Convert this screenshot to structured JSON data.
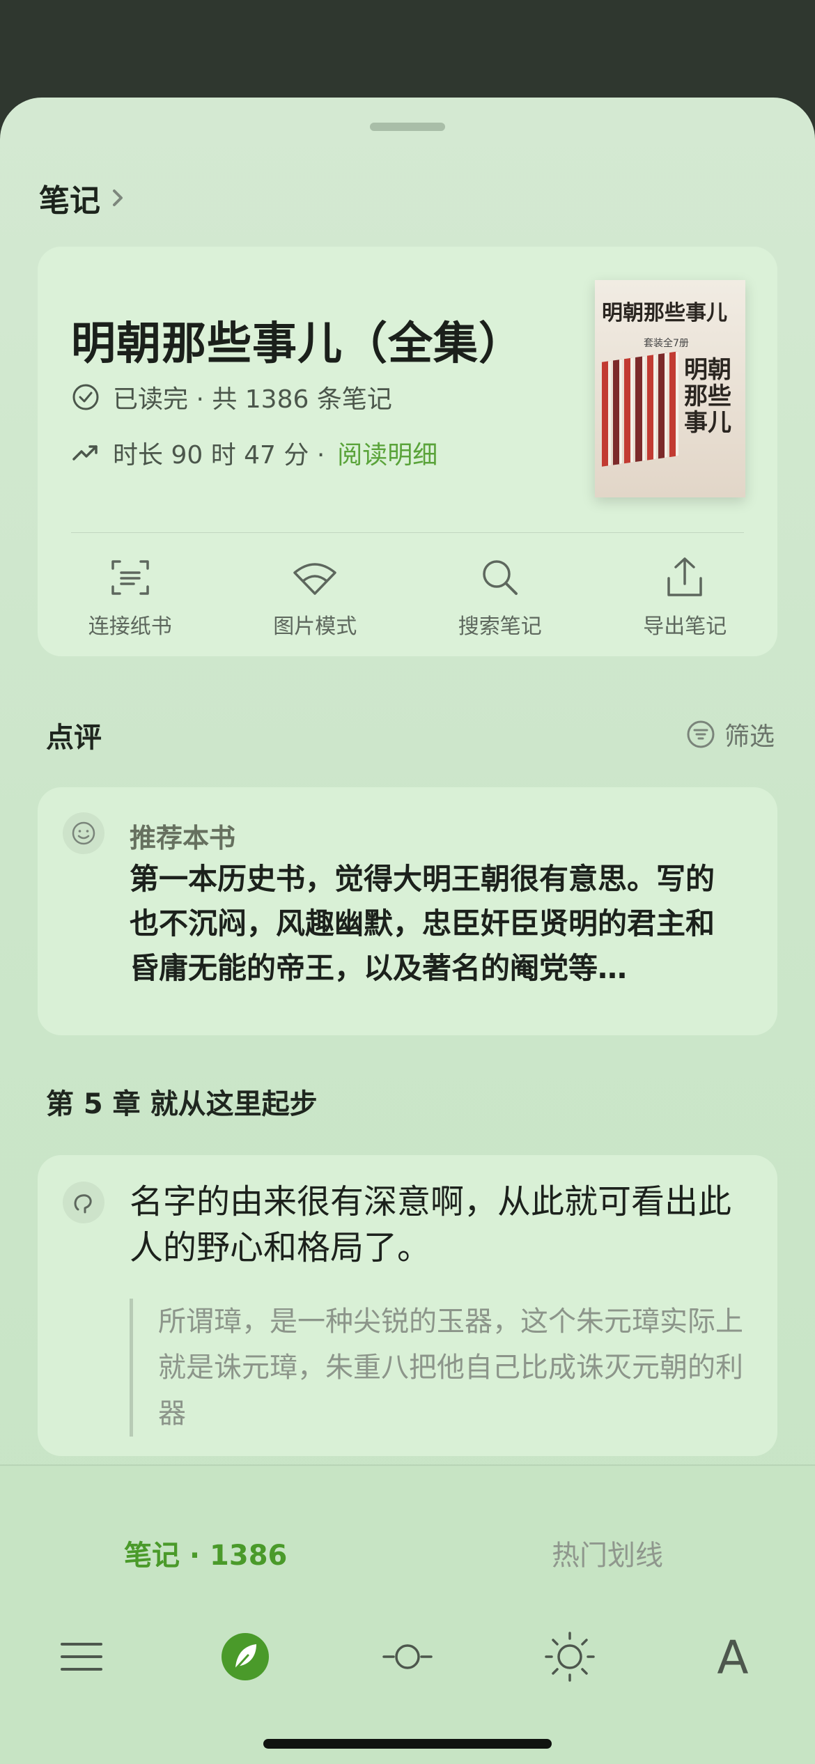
{
  "header": {
    "title": "笔记"
  },
  "book": {
    "title": "明朝那些事儿（全集）",
    "status": "已读完 · 共 1386 条笔记",
    "duration": "时长 90 时 47 分 ·",
    "detail_link": "阅读明细",
    "cover_title": "明朝那些事儿",
    "cover_subtitle": "套装全7册",
    "cover_vertical": "明朝那些事儿"
  },
  "tools": [
    {
      "label": "连接纸书",
      "icon": "scan-icon"
    },
    {
      "label": "图片模式",
      "icon": "fan-icon"
    },
    {
      "label": "搜索笔记",
      "icon": "search-icon"
    },
    {
      "label": "导出笔记",
      "icon": "export-icon"
    }
  ],
  "review_section": {
    "title": "点评",
    "filter_label": "筛选"
  },
  "review": {
    "label": "推荐本书",
    "text": "第一本历史书，觉得大明王朝很有意思。写的也不沉闷，风趣幽默，忠臣奸臣贤明的君主和昏庸无能的帝王，以及著名的阉党等…"
  },
  "chapter": {
    "title": "第 5 章 就从这里起步",
    "note": "名字的由来很有深意啊，从此就可看出此人的野心和格局了。",
    "quote": "所谓璋，是一种尖锐的玉器，这个朱元璋实际上就是诛元璋，朱重八把他自己比成诛灭元朝的利器"
  },
  "bottom": {
    "tab_notes": "笔记 · 1386",
    "tab_hot": "热门划线",
    "nav_icons": [
      "menu-icon",
      "leaf-icon",
      "progress-icon",
      "brightness-icon",
      "font-icon"
    ],
    "font_glyph": "A"
  },
  "colors": {
    "accent": "#5aa33a",
    "background": "#cce6ca",
    "card": "#d9f0d6"
  }
}
